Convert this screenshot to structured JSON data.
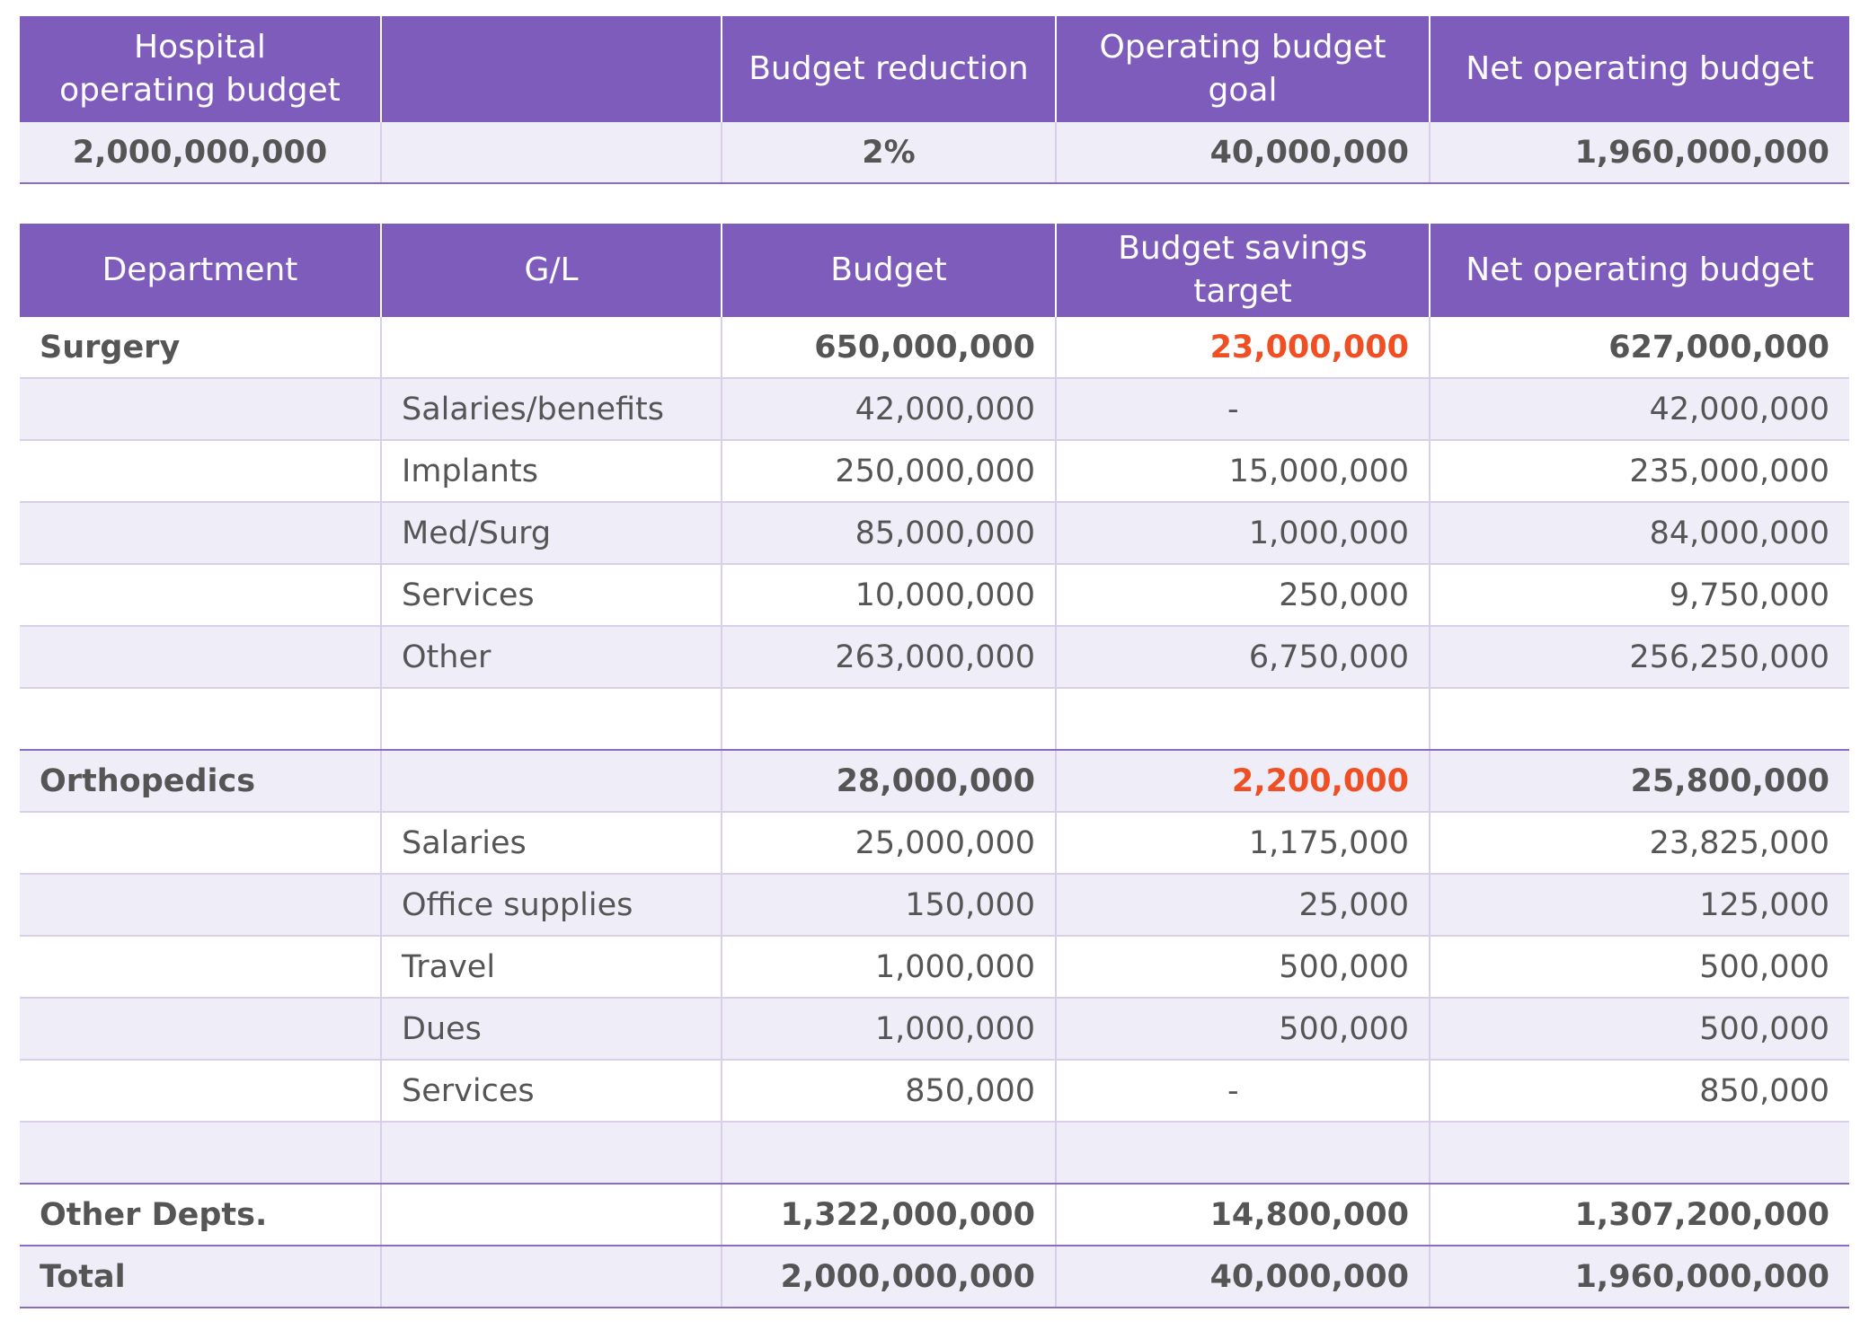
{
  "summary": {
    "headers": [
      "Hospital operating budget",
      "",
      "Budget reduction",
      "Operating budget goal",
      "Net operating budget"
    ],
    "values": [
      "2,000,000,000",
      "",
      "2%",
      "40,000,000",
      "1,960,000,000"
    ]
  },
  "main": {
    "headers": [
      "Department",
      "G/L",
      "Budget",
      "Budget savings target",
      "Net operating budget"
    ],
    "rows": [
      {
        "dept": "Surgery",
        "gl": "",
        "budget": "650,000,000",
        "savings": "23,000,000",
        "net": "627,000,000"
      },
      {
        "dept": "",
        "gl": "Salaries/benefits",
        "budget": "42,000,000",
        "savings": "-",
        "net": "42,000,000"
      },
      {
        "dept": "",
        "gl": "Implants",
        "budget": "250,000,000",
        "savings": "15,000,000",
        "net": "235,000,000"
      },
      {
        "dept": "",
        "gl": "Med/Surg",
        "budget": "85,000,000",
        "savings": "1,000,000",
        "net": "84,000,000"
      },
      {
        "dept": "",
        "gl": "Services",
        "budget": "10,000,000",
        "savings": "250,000",
        "net": "9,750,000"
      },
      {
        "dept": "",
        "gl": "Other",
        "budget": "263,000,000",
        "savings": "6,750,000",
        "net": "256,250,000"
      },
      {
        "dept": "",
        "gl": "",
        "budget": "",
        "savings": "",
        "net": ""
      },
      {
        "dept": "Orthopedics",
        "gl": "",
        "budget": "28,000,000",
        "savings": "2,200,000",
        "net": "25,800,000"
      },
      {
        "dept": "",
        "gl": "Salaries",
        "budget": "25,000,000",
        "savings": "1,175,000",
        "net": "23,825,000"
      },
      {
        "dept": "",
        "gl": "Office supplies",
        "budget": "150,000",
        "savings": "25,000",
        "net": "125,000"
      },
      {
        "dept": "",
        "gl": "Travel",
        "budget": "1,000,000",
        "savings": "500,000",
        "net": "500,000"
      },
      {
        "dept": "",
        "gl": "Dues",
        "budget": "1,000,000",
        "savings": "500,000",
        "net": "500,000"
      },
      {
        "dept": "",
        "gl": "Services",
        "budget": "850,000",
        "savings": "-",
        "net": "850,000"
      },
      {
        "dept": "",
        "gl": "",
        "budget": "",
        "savings": "",
        "net": ""
      },
      {
        "dept": "Other Depts.",
        "gl": "",
        "budget": "1,322,000,000",
        "savings": "14,800,000",
        "net": "1,307,200,000"
      },
      {
        "dept": "Total",
        "gl": "",
        "budget": "2,000,000,000",
        "savings": "40,000,000",
        "net": "1,960,000,000"
      }
    ]
  },
  "colors": {
    "header_bg": "#7e5cbc",
    "alt_row_bg": "#efedf7",
    "highlight_text": "#f04e23",
    "body_text": "#555555"
  }
}
